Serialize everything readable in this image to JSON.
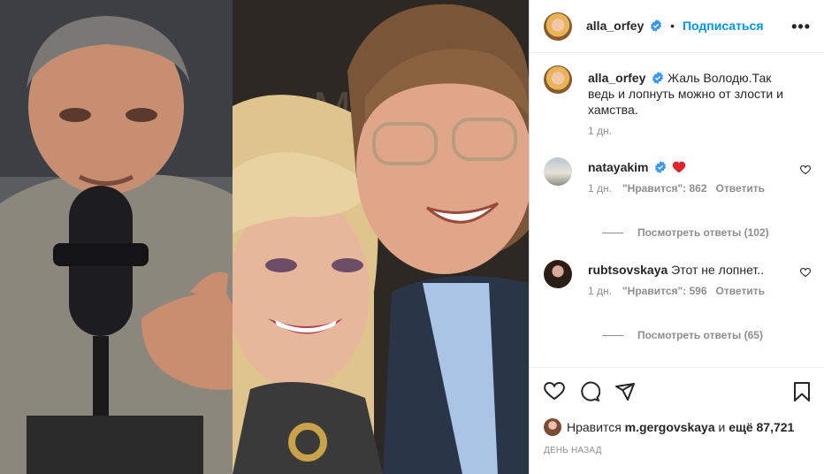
{
  "post": {
    "author": "alla_orfey",
    "follow_label": "Подписаться",
    "more_label": "•••",
    "caption_author": "alla_orfey",
    "caption_text": "Жаль Володю.Так ведь и лопнуть можно от злости и хамства.",
    "caption_time": "1 дн."
  },
  "comments": [
    {
      "author": "natayakim",
      "text": "",
      "time": "1 дн.",
      "likes": "\"Нравится\": 862",
      "reply_label": "Ответить",
      "view_replies": "Посмотреть ответы (102)"
    },
    {
      "author": "rubtsovskaya",
      "text": "Этот не лопнет..",
      "time": "1 дн.",
      "likes": "\"Нравится\": 596",
      "reply_label": "Ответить",
      "view_replies": "Посмотреть ответы (65)"
    }
  ],
  "footer": {
    "liked_prefix": "Нравится",
    "liked_user": "m.gergovskaya",
    "liked_and": "и",
    "liked_count": "ещё 87,721",
    "date": "ДЕНЬ НАЗАД"
  },
  "colors": {
    "accent": "#0095f6",
    "verified": "#3897f0",
    "heart": "#ed4956",
    "muted": "#8e8e8e"
  },
  "icons": [
    "verified-badge-icon",
    "heart-icon",
    "comment-icon",
    "share-icon",
    "bookmark-icon",
    "more-icon"
  ]
}
